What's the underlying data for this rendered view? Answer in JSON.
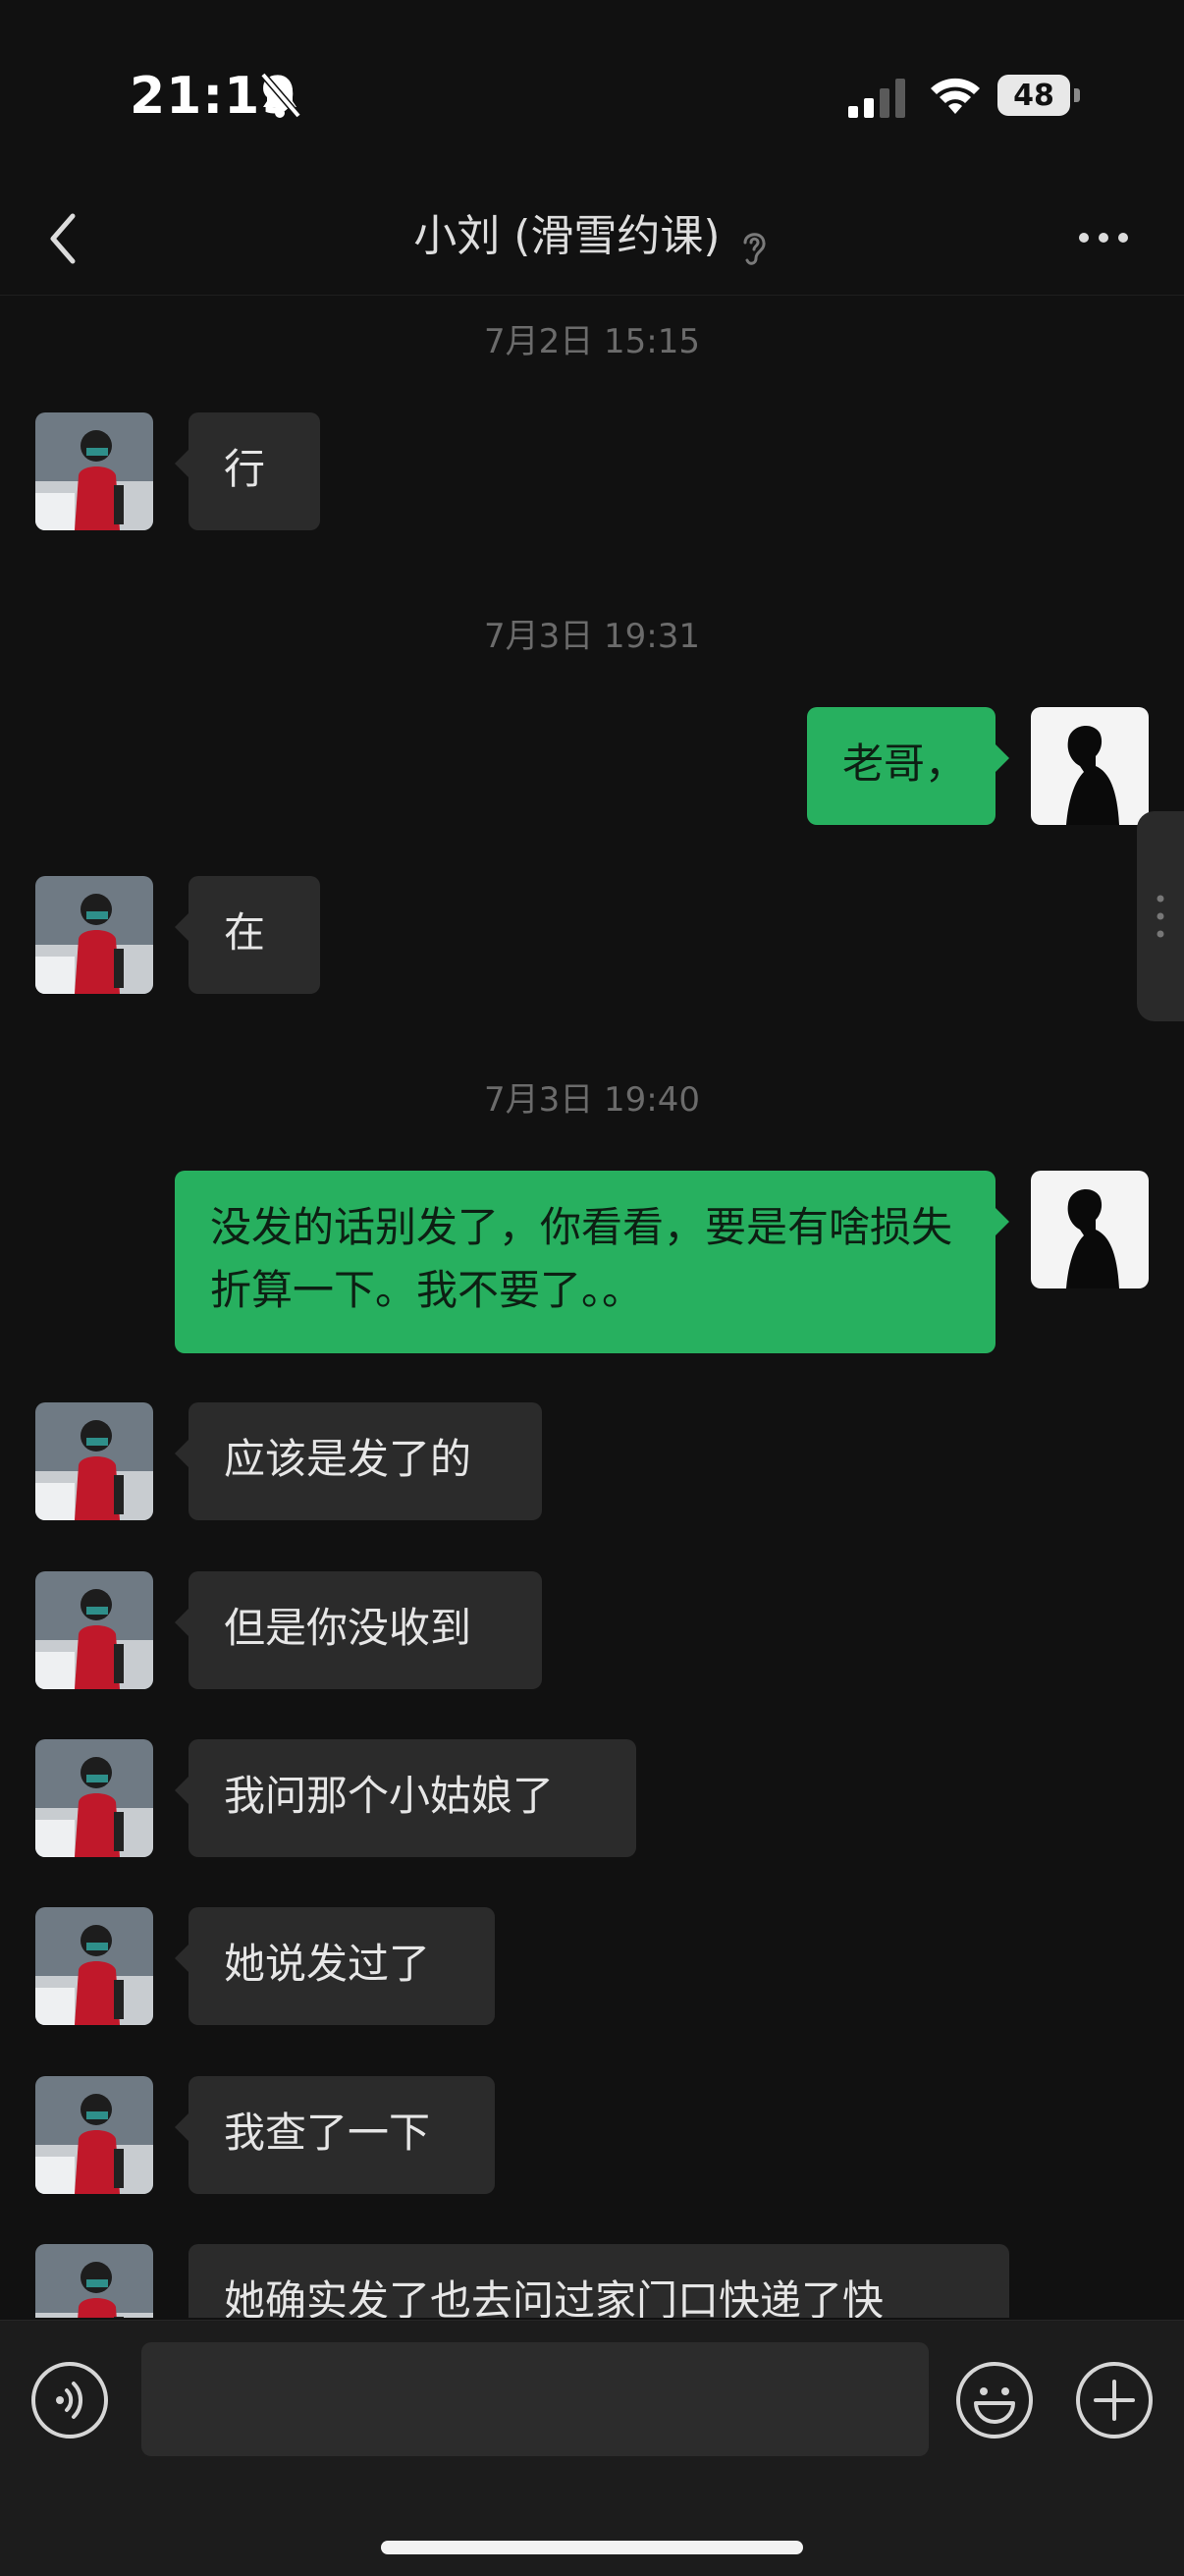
{
  "status_bar": {
    "time": "21:19",
    "battery": "48",
    "icons": [
      "bell-slash-icon",
      "cellular-signal-icon",
      "wifi-icon",
      "battery-icon"
    ]
  },
  "nav": {
    "title": "小刘 (滑雪约课)",
    "icons": [
      "back-chevron-icon",
      "ear-icon",
      "more-dots-icon"
    ]
  },
  "messages": [
    {
      "type": "time",
      "text": "7月2日 15:15"
    },
    {
      "type": "in",
      "text": "行"
    },
    {
      "type": "time",
      "text": "7月3日 19:31"
    },
    {
      "type": "out",
      "text": "老哥，"
    },
    {
      "type": "in",
      "text": "在"
    },
    {
      "type": "time",
      "text": "7月3日 19:40"
    },
    {
      "type": "out",
      "text": "没发的话别发了，你看看，要是有啥损失折算一下。我不要了。。"
    },
    {
      "type": "in",
      "text": "应该是发了的"
    },
    {
      "type": "in",
      "text": "但是你没收到"
    },
    {
      "type": "in",
      "text": "我问那个小姑娘了"
    },
    {
      "type": "in",
      "text": "她说发过了"
    },
    {
      "type": "in",
      "text": "我查了一下"
    },
    {
      "type": "in",
      "text": "她确实发了也去问过家门口快递了快"
    }
  ],
  "input_bar": {
    "placeholder": "",
    "icons": [
      "voice-icon",
      "emoji-icon",
      "plus-icon"
    ]
  },
  "colors": {
    "background": "#111111",
    "incoming_bubble": "#2b2b2b",
    "outgoing_bubble": "#27b05f"
  }
}
